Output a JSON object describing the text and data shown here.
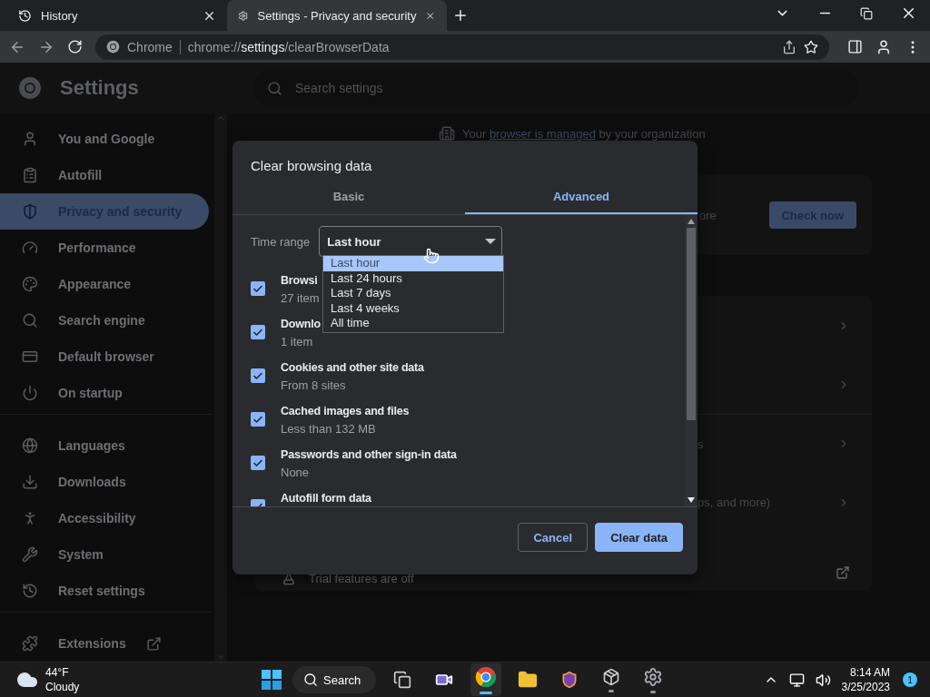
{
  "browser": {
    "tabs": [
      {
        "title": "History",
        "selected": false
      },
      {
        "title": "Settings - Privacy and security",
        "selected": true
      }
    ],
    "omnibox": {
      "site_label": "Chrome",
      "url_scheme": "chrome://",
      "url_host": "settings",
      "url_path": "/clearBrowserData"
    }
  },
  "settings": {
    "title": "Settings",
    "search": {
      "placeholder": "Search settings"
    },
    "sidebar": {
      "sections": [
        {
          "items": [
            {
              "label": "You and Google",
              "selected": false
            },
            {
              "label": "Autofill",
              "selected": false
            },
            {
              "label": "Privacy and security",
              "selected": true
            },
            {
              "label": "Performance",
              "selected": false
            },
            {
              "label": "Appearance",
              "selected": false
            },
            {
              "label": "Search engine",
              "selected": false
            },
            {
              "label": "Default browser",
              "selected": false
            },
            {
              "label": "On startup",
              "selected": false
            }
          ]
        },
        {
          "items": [
            {
              "label": "Languages",
              "selected": false
            },
            {
              "label": "Downloads",
              "selected": false
            },
            {
              "label": "Accessibility",
              "selected": false
            },
            {
              "label": "System",
              "selected": false
            },
            {
              "label": "Reset settings",
              "selected": false
            }
          ]
        },
        {
          "items": [
            {
              "label": "Extensions",
              "selected": false,
              "external": true
            }
          ]
        }
      ]
    },
    "managed_notice": {
      "before": "Your ",
      "link": "browser is managed",
      "after": " by your organization"
    },
    "safety_card": {
      "fragment": "ore",
      "button": "Check now"
    },
    "privacy_rows": [
      {
        "fragment": "s"
      },
      {
        "fragment": "ps, and more)"
      }
    ],
    "trial_row": {
      "text": "Trial features are off"
    }
  },
  "dialog": {
    "title": "Clear browsing data",
    "tabs": [
      {
        "label": "Basic",
        "selected": false
      },
      {
        "label": "Advanced",
        "selected": true
      }
    ],
    "time_range": {
      "label": "Time range",
      "value": "Last hour",
      "expanded": true,
      "options": [
        {
          "label": "Last hour",
          "selected": true
        },
        {
          "label": "Last 24 hours",
          "selected": false
        },
        {
          "label": "Last 7 days",
          "selected": false
        },
        {
          "label": "Last 4 weeks",
          "selected": false
        },
        {
          "label": "All time",
          "selected": false
        }
      ]
    },
    "items": [
      {
        "title": "Browsi",
        "detail": "27 item",
        "checked": true
      },
      {
        "title": "Downlo",
        "detail": "1 item",
        "checked": true
      },
      {
        "title": "Cookies and other site data",
        "detail": "From 8 sites",
        "checked": true
      },
      {
        "title": "Cached images and files",
        "detail": "Less than 132 MB",
        "checked": true
      },
      {
        "title": "Passwords and other sign-in data",
        "detail": "None",
        "checked": true
      },
      {
        "title": "Autofill form data",
        "checked": true
      }
    ],
    "buttons": [
      {
        "label": "Cancel",
        "kind": "secondary"
      },
      {
        "label": "Clear data",
        "kind": "primary"
      }
    ]
  },
  "taskbar": {
    "weather": {
      "temperature": "44°F",
      "condition": "Cloudy"
    },
    "search": "Search",
    "clock": {
      "time": "8:14 AM",
      "date": "3/25/2023"
    },
    "notifications": "1"
  }
}
